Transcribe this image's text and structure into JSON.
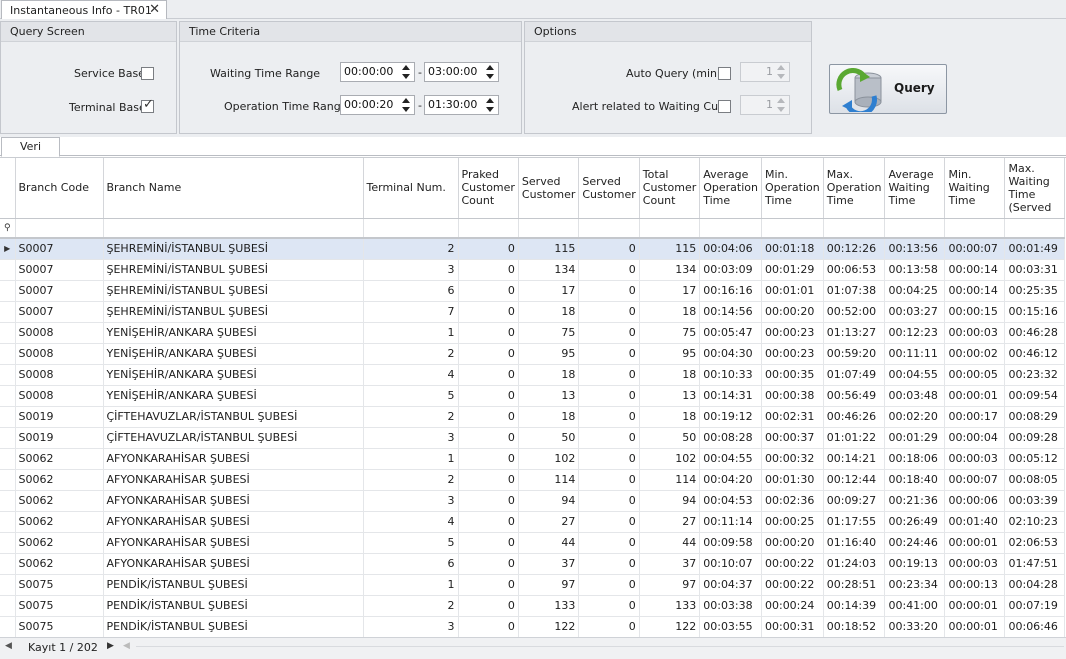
{
  "document_tab": {
    "title": "Instantaneous Info - TR01",
    "close": "✕"
  },
  "query_screen": {
    "header": "Query Screen",
    "service_base": {
      "label": "Service Base",
      "checked": false
    },
    "terminal_base": {
      "label": "Terminal Base",
      "checked": true
    }
  },
  "time_criteria": {
    "header": "Time Criteria",
    "waiting": {
      "label": "Waiting Time Range",
      "from": "00:00:00",
      "to": "03:00:00"
    },
    "operation": {
      "label": "Operation Time Range",
      "from": "00:00:20",
      "to": "01:30:00"
    },
    "sep": "-"
  },
  "options": {
    "header": "Options",
    "auto_query": {
      "label": "Auto Query (min.)",
      "checked": false,
      "value": "1"
    },
    "alert": {
      "label": "Alert related to Waiting Cust.",
      "checked": false,
      "value": "1"
    }
  },
  "query_button": {
    "label": "Query",
    "icon": "refresh-database-icon"
  },
  "sub_tab": {
    "label": "Veri"
  },
  "grid": {
    "columns": [
      "Branch Code",
      "Branch Name",
      "Terminal Num.",
      "Praked Customer Count",
      "Served Customer",
      "Served Customer",
      "Total Customer Count",
      "Average Operation Time",
      "Min. Operation Time",
      "Max. Operation Time",
      "Average Waiting Time",
      "Min. Waiting Time",
      "Max. Waiting Time (Served"
    ],
    "rows": [
      [
        "S0007",
        "ŞEHREMİNİ/İSTANBUL ŞUBESİ",
        "2",
        "0",
        "115",
        "0",
        "115",
        "00:04:06",
        "00:01:18",
        "00:12:26",
        "00:13:56",
        "00:00:07",
        "00:01:49"
      ],
      [
        "S0007",
        "ŞEHREMİNİ/İSTANBUL ŞUBESİ",
        "3",
        "0",
        "134",
        "0",
        "134",
        "00:03:09",
        "00:01:29",
        "00:06:53",
        "00:13:58",
        "00:00:14",
        "00:03:31"
      ],
      [
        "S0007",
        "ŞEHREMİNİ/İSTANBUL ŞUBESİ",
        "6",
        "0",
        "17",
        "0",
        "17",
        "00:16:16",
        "00:01:01",
        "01:07:38",
        "00:04:25",
        "00:00:14",
        "00:25:35"
      ],
      [
        "S0007",
        "ŞEHREMİNİ/İSTANBUL ŞUBESİ",
        "7",
        "0",
        "18",
        "0",
        "18",
        "00:14:56",
        "00:00:20",
        "00:52:00",
        "00:03:27",
        "00:00:15",
        "00:15:16"
      ],
      [
        "S0008",
        "YENİŞEHİR/ANKARA ŞUBESİ",
        "1",
        "0",
        "75",
        "0",
        "75",
        "00:05:47",
        "00:00:23",
        "01:13:27",
        "00:12:23",
        "00:00:03",
        "00:46:28"
      ],
      [
        "S0008",
        "YENİŞEHİR/ANKARA ŞUBESİ",
        "2",
        "0",
        "95",
        "0",
        "95",
        "00:04:30",
        "00:00:23",
        "00:59:20",
        "00:11:11",
        "00:00:02",
        "00:46:12"
      ],
      [
        "S0008",
        "YENİŞEHİR/ANKARA ŞUBESİ",
        "4",
        "0",
        "18",
        "0",
        "18",
        "00:10:33",
        "00:00:35",
        "01:07:49",
        "00:04:55",
        "00:00:05",
        "00:23:32"
      ],
      [
        "S0008",
        "YENİŞEHİR/ANKARA ŞUBESİ",
        "5",
        "0",
        "13",
        "0",
        "13",
        "00:14:31",
        "00:00:38",
        "00:56:49",
        "00:03:48",
        "00:00:01",
        "00:09:54"
      ],
      [
        "S0019",
        "ÇİFTEHAVUZLAR/İSTANBUL ŞUBESİ",
        "2",
        "0",
        "18",
        "0",
        "18",
        "00:19:12",
        "00:02:31",
        "00:46:26",
        "00:02:20",
        "00:00:17",
        "00:08:29"
      ],
      [
        "S0019",
        "ÇİFTEHAVUZLAR/İSTANBUL ŞUBESİ",
        "3",
        "0",
        "50",
        "0",
        "50",
        "00:08:28",
        "00:00:37",
        "01:01:22",
        "00:01:29",
        "00:00:04",
        "00:09:28"
      ],
      [
        "S0062",
        "AFYONKARAHİSAR ŞUBESİ",
        "1",
        "0",
        "102",
        "0",
        "102",
        "00:04:55",
        "00:00:32",
        "00:14:21",
        "00:18:06",
        "00:00:03",
        "00:05:12"
      ],
      [
        "S0062",
        "AFYONKARAHİSAR ŞUBESİ",
        "2",
        "0",
        "114",
        "0",
        "114",
        "00:04:20",
        "00:01:30",
        "00:12:44",
        "00:18:40",
        "00:00:07",
        "00:08:05"
      ],
      [
        "S0062",
        "AFYONKARAHİSAR ŞUBESİ",
        "3",
        "0",
        "94",
        "0",
        "94",
        "00:04:53",
        "00:02:36",
        "00:09:27",
        "00:21:36",
        "00:00:06",
        "00:03:39"
      ],
      [
        "S0062",
        "AFYONKARAHİSAR ŞUBESİ",
        "4",
        "0",
        "27",
        "0",
        "27",
        "00:11:14",
        "00:00:25",
        "01:17:55",
        "00:26:49",
        "00:01:40",
        "02:10:23"
      ],
      [
        "S0062",
        "AFYONKARAHİSAR ŞUBESİ",
        "5",
        "0",
        "44",
        "0",
        "44",
        "00:09:58",
        "00:00:20",
        "01:16:40",
        "00:24:46",
        "00:00:01",
        "02:06:53"
      ],
      [
        "S0062",
        "AFYONKARAHİSAR ŞUBESİ",
        "6",
        "0",
        "37",
        "0",
        "37",
        "00:10:07",
        "00:00:22",
        "01:24:03",
        "00:19:13",
        "00:00:03",
        "01:47:51"
      ],
      [
        "S0075",
        "PENDİK/İSTANBUL ŞUBESİ",
        "1",
        "0",
        "97",
        "0",
        "97",
        "00:04:37",
        "00:00:22",
        "00:28:51",
        "00:23:34",
        "00:00:13",
        "00:04:28"
      ],
      [
        "S0075",
        "PENDİK/İSTANBUL ŞUBESİ",
        "2",
        "0",
        "133",
        "0",
        "133",
        "00:03:38",
        "00:00:24",
        "00:14:39",
        "00:41:00",
        "00:00:01",
        "00:07:19"
      ],
      [
        "S0075",
        "PENDİK/İSTANBUL ŞUBESİ",
        "3",
        "0",
        "122",
        "0",
        "122",
        "00:03:55",
        "00:00:31",
        "00:18:52",
        "00:33:20",
        "00:00:01",
        "00:06:46"
      ]
    ],
    "selected_row": 0
  },
  "pager": {
    "record_text": "Kayıt 1 / 202"
  }
}
